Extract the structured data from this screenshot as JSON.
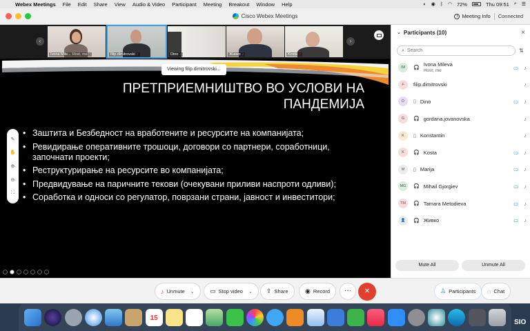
{
  "menubar": {
    "app_name": "Webex Meetings",
    "menus": [
      "File",
      "Edit",
      "Share",
      "View",
      "Audio & Video",
      "Participant",
      "Meeting",
      "Breakout",
      "Window",
      "Help"
    ],
    "battery": "72%",
    "clock": "Thu 09:51"
  },
  "window": {
    "title": "Cisco Webex Meetings",
    "meeting_info": "Meeting Info",
    "status": "Connected"
  },
  "video_strip": [
    {
      "name": "Ivona Mile...",
      "suffix": "Host, me"
    },
    {
      "name": "filip.dimitrovski",
      "suffix": ""
    },
    {
      "name": "Dino",
      "suffix": ""
    },
    {
      "name": "Живко",
      "suffix": ""
    },
    {
      "name": "Kosta",
      "suffix": ""
    }
  ],
  "slide": {
    "viewing_label": "Viewing filip.dimitrovski...",
    "title": "ПРЕТПРИЕМНИШТВО ВО УСЛОВИ НА ПАНДЕМИЈА",
    "bullets": [
      "Заштита и Безбедност на вработените и ресурсите на компанијата;",
      "Ревидирање оперативните трошоци, договори со партнери, соработници, започнати проекти;",
      "Реструктурирање на ресурсите во компанијата;",
      "Предвидување на паричните текови (очекувани приливи наспроти одливи);",
      "Соработка и односи со регулатор, поврзани страни, јавност и инвеститори;"
    ]
  },
  "controls": {
    "unmute": "Unmute",
    "stop_video": "Stop video",
    "share": "Share",
    "record": "Record",
    "participants": "Participants",
    "chat": "Chat"
  },
  "panel": {
    "title": "Participants (10)",
    "search_placeholder": "Search",
    "mute_all": "Mute All",
    "unmute_all": "Unmute All",
    "participants": [
      {
        "initials": "IM",
        "name": "Ivona Mileva",
        "role": "Host, me",
        "device": "headset",
        "video": true,
        "mic": "muted",
        "color": "#d8eedc"
      },
      {
        "initials": "F",
        "name": "filip.dimitrovski",
        "role": "",
        "device": "",
        "video": false,
        "mic": "active",
        "color": "#f7dcdc"
      },
      {
        "initials": "D",
        "name": "Dino",
        "role": "",
        "device": "phone",
        "video": true,
        "mic": "muted",
        "color": "#e6dcf3"
      },
      {
        "initials": "G",
        "name": "gordana.jovanovska",
        "role": "",
        "device": "headset",
        "video": false,
        "mic": "muted",
        "color": "#f7dcdc"
      },
      {
        "initials": "K",
        "name": "Konstantin",
        "role": "",
        "device": "phone",
        "video": false,
        "mic": "muted",
        "color": "#f6ead0"
      },
      {
        "initials": "K",
        "name": "Kosta",
        "role": "",
        "device": "headset",
        "video": true,
        "mic": "muted",
        "color": "#f7dcdc"
      },
      {
        "initials": "M",
        "name": "Marija",
        "role": "",
        "device": "phone",
        "video": true,
        "mic": "muted",
        "color": "#ececec"
      },
      {
        "initials": "MG",
        "name": "Mihail Gjorgiev",
        "role": "",
        "device": "headset",
        "video": true,
        "mic": "muted",
        "color": "#d8eedc"
      },
      {
        "initials": "TM",
        "name": "Tamara Metodieva",
        "role": "",
        "device": "headset",
        "video": true,
        "mic": "muted",
        "color": "#f7dcdc"
      },
      {
        "initials": "",
        "name": "Живко",
        "role": "",
        "device": "headset",
        "video": true,
        "mic": "muted",
        "color": "#ececec"
      }
    ]
  },
  "dock": {
    "calendar_day": "15",
    "desktop_text": "SIO"
  }
}
